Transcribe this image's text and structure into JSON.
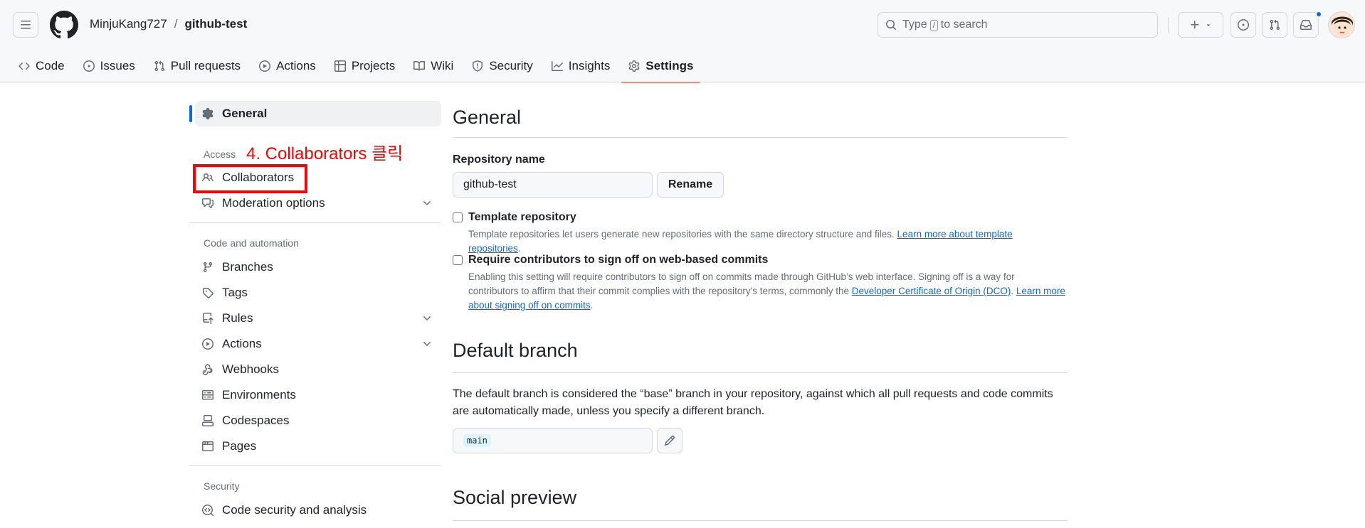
{
  "header": {
    "owner": "MinjuKang727",
    "separator": "/",
    "repo": "github-test",
    "search_prefix": "Type",
    "search_key": "/",
    "search_suffix": "to search"
  },
  "tabs": [
    {
      "label": "Code",
      "icon": "code-icon"
    },
    {
      "label": "Issues",
      "icon": "issue-icon"
    },
    {
      "label": "Pull requests",
      "icon": "pull-request-icon"
    },
    {
      "label": "Actions",
      "icon": "play-icon"
    },
    {
      "label": "Projects",
      "icon": "table-icon"
    },
    {
      "label": "Wiki",
      "icon": "book-icon"
    },
    {
      "label": "Security",
      "icon": "shield-icon"
    },
    {
      "label": "Insights",
      "icon": "graph-icon"
    },
    {
      "label": "Settings",
      "icon": "gear-icon",
      "active": true
    }
  ],
  "sidebar": {
    "general": "General",
    "group_access": "Access",
    "collaborators": "Collaborators",
    "moderation": "Moderation options",
    "group_code": "Code and automation",
    "branches": "Branches",
    "tags": "Tags",
    "rules": "Rules",
    "actions": "Actions",
    "webhooks": "Webhooks",
    "environments": "Environments",
    "codespaces": "Codespaces",
    "pages": "Pages",
    "group_security": "Security",
    "code_security": "Code security and analysis"
  },
  "annotation": {
    "text": "4. Collaborators 클릭",
    "color": "#ff0000"
  },
  "main": {
    "title": "General",
    "repo_name_label": "Repository name",
    "repo_name_value": "github-test",
    "rename_button": "Rename",
    "template_title": "Template repository",
    "template_note": "Template repositories let users generate new repositories with the same directory structure and files.",
    "template_link": "Learn more about template repositories",
    "signoff_title": "Require contributors to sign off on web-based commits",
    "signoff_note_1": "Enabling this setting will require contributors to sign off on commits made through GitHub’s web interface. Signing off is a way for contributors to affirm that their commit complies with the repository's terms, commonly the",
    "signoff_link_1": "Developer Certificate of Origin (DCO)",
    "signoff_link_2": "Learn more about signing off on commits",
    "default_branch_title": "Default branch",
    "default_branch_desc": "The default branch is considered the “base” branch in your repository, against which all pull requests and code commits are automatically made, unless you specify a different branch.",
    "default_branch_value": "main",
    "social_title": "Social preview"
  },
  "colors": {
    "accent": "#0969da",
    "active_tab_underline": "#fd8c73",
    "annotation": "#ff0000"
  }
}
